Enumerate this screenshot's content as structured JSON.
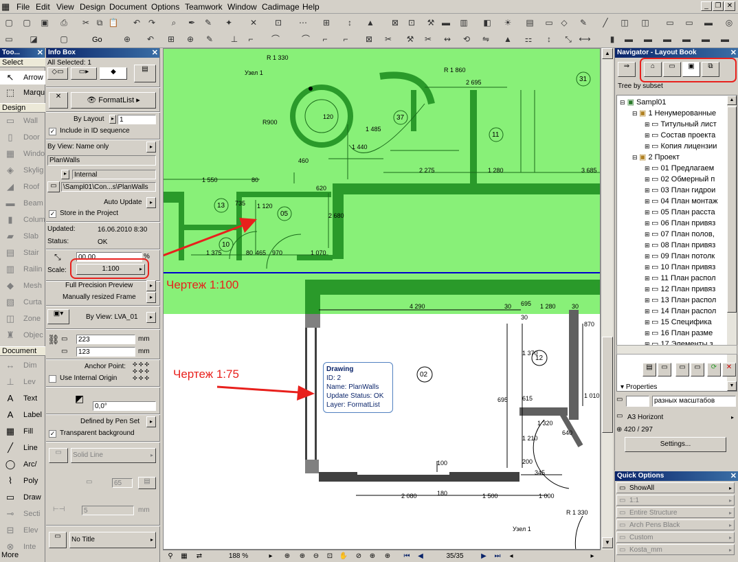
{
  "menu": {
    "items": [
      "File",
      "Edit",
      "View",
      "Design",
      "Document",
      "Options",
      "Teamwork",
      "Window",
      "Cadimage",
      "Help"
    ]
  },
  "toolbar2": {
    "go_label": "Go"
  },
  "toolbox": {
    "title": "Too...",
    "select_header": "Select",
    "arrow": "Arrow",
    "marquee": "Marqu",
    "design_header": "Design",
    "tools": [
      "Wall",
      "Door",
      "Windo",
      "Skylig",
      "Roof",
      "Beam",
      "Colum",
      "Slab",
      "Stair",
      "Railin",
      "Mesh",
      "Curta",
      "Zone",
      "Objec"
    ],
    "document_header": "Document",
    "doc_tools": [
      "Dim",
      "Lev",
      "Text",
      "Label",
      "Fill",
      "Line",
      "Arc/",
      "Poly",
      "Draw",
      "Secti",
      "Elev",
      "Inte"
    ],
    "more": "More"
  },
  "infobox": {
    "title": "Info Box",
    "selected": "All Selected: 1",
    "format_list": "FormatList",
    "by_layout": "By Layout",
    "layout_value": "1",
    "include_id": "Include in ID sequence",
    "by_view": "By View: Name only",
    "plan_walls": "PlanWalls",
    "internal": "Internal",
    "path": "\\Sampl01\\Con...s\\PlanWalls",
    "auto_update": "Auto Update",
    "store_project": "Store in the Project",
    "updated_label": "Updated:",
    "updated_value": "16.06.2010 8:30",
    "status_label": "Status:",
    "status_value": "OK",
    "percent_value": "00,00",
    "percent_unit": "%",
    "scale_label": "Scale:",
    "scale_value": "1:100",
    "full_precision": "Full Precision Preview",
    "manual_frame": "Manually resized Frame",
    "by_view_lva": "By View: LVA_01",
    "width_value": "223",
    "height_value": "123",
    "unit_mm": "mm",
    "anchor_point": "Anchor Point:",
    "use_origin": "Use Internal Origin",
    "angle_value": "0,0°",
    "pen_set": "Defined by Pen Set",
    "transparent_bg": "Transparent background",
    "solid_line": "Solid Line",
    "pen_value": "65",
    "offset_value": "5",
    "offset_unit": "mm",
    "no_title": "No Title"
  },
  "canvas": {
    "label_100": "Чертеж 1:100",
    "label_75": "Чертеж 1:75",
    "tooltip": {
      "title": "Drawing",
      "id": "ID: 2",
      "name": "Name: PlanWalls",
      "status": "Update Status: OK",
      "layer": "Layer: FormatList"
    },
    "dims": [
      "R 1 330",
      "Узел 1",
      "R 1 860",
      "2 695",
      "R900",
      "120",
      "1 485",
      "1 440",
      "2 275",
      "1 280",
      "3 685",
      "1 550",
      "80",
      "2 680",
      "735",
      "1 120",
      "1 375",
      "80",
      "465",
      "970",
      "1 070",
      "460",
      "620",
      "4 290",
      "30",
      "695",
      "1 280",
      "30",
      "870",
      "1 370",
      "1 320",
      "615",
      "695",
      "1 210",
      "200",
      "345",
      "1 010",
      "100",
      "2 080",
      "180",
      "1 500",
      "1 000",
      "R 1 330",
      "Узел 1",
      "640",
      "30"
    ],
    "rooms": [
      "31",
      "37",
      "11",
      "13",
      "05",
      "10",
      "12",
      "02"
    ]
  },
  "statusbar": {
    "zoom": "188 %",
    "pages": "35/35"
  },
  "navigator": {
    "title": "Navigator - Layout Book",
    "tree_label": "Tree by subset",
    "root": "Sampl01",
    "items": [
      {
        "label": "1 Ненумерованные",
        "level": 1,
        "folder": true
      },
      {
        "label": "Титульный лист",
        "level": 2
      },
      {
        "label": "Состав проекта",
        "level": 2
      },
      {
        "label": "Копия лицензии",
        "level": 2
      },
      {
        "label": "2 Проект",
        "level": 1,
        "folder": true
      },
      {
        "label": "01 Предлагаем",
        "level": 2
      },
      {
        "label": "02 Обмерный п",
        "level": 2
      },
      {
        "label": "03 План гидрои",
        "level": 2
      },
      {
        "label": "04 План монтаж",
        "level": 2
      },
      {
        "label": "05 План расста",
        "level": 2
      },
      {
        "label": "06 План привяз",
        "level": 2
      },
      {
        "label": "07 План полов,",
        "level": 2
      },
      {
        "label": "08 План привяз",
        "level": 2
      },
      {
        "label": "09 План потолк",
        "level": 2
      },
      {
        "label": "10 План привяз",
        "level": 2
      },
      {
        "label": "11 План распол",
        "level": 2
      },
      {
        "label": "12 План привяз",
        "level": 2
      },
      {
        "label": "13 План распол",
        "level": 2
      },
      {
        "label": "14 План распол",
        "level": 2
      },
      {
        "label": "15 Специфика",
        "level": 2
      },
      {
        "label": "16 План разме",
        "level": 2
      },
      {
        "label": "17 Элементы з",
        "level": 2
      }
    ],
    "properties": "Properties",
    "prop_name": "разных масштабов",
    "paper": "A3 Horizont",
    "size": "420 / 297",
    "settings": "Settings..."
  },
  "quick": {
    "title": "Quick Options",
    "items": [
      "ShowAll",
      "1:1",
      "Entire Structure",
      "Arch Pens Black",
      "Custom",
      "Kosta_mm"
    ]
  },
  "colors": {
    "green": "#88f078",
    "highlight": "#e8201c",
    "blueline": "#0000cc"
  }
}
